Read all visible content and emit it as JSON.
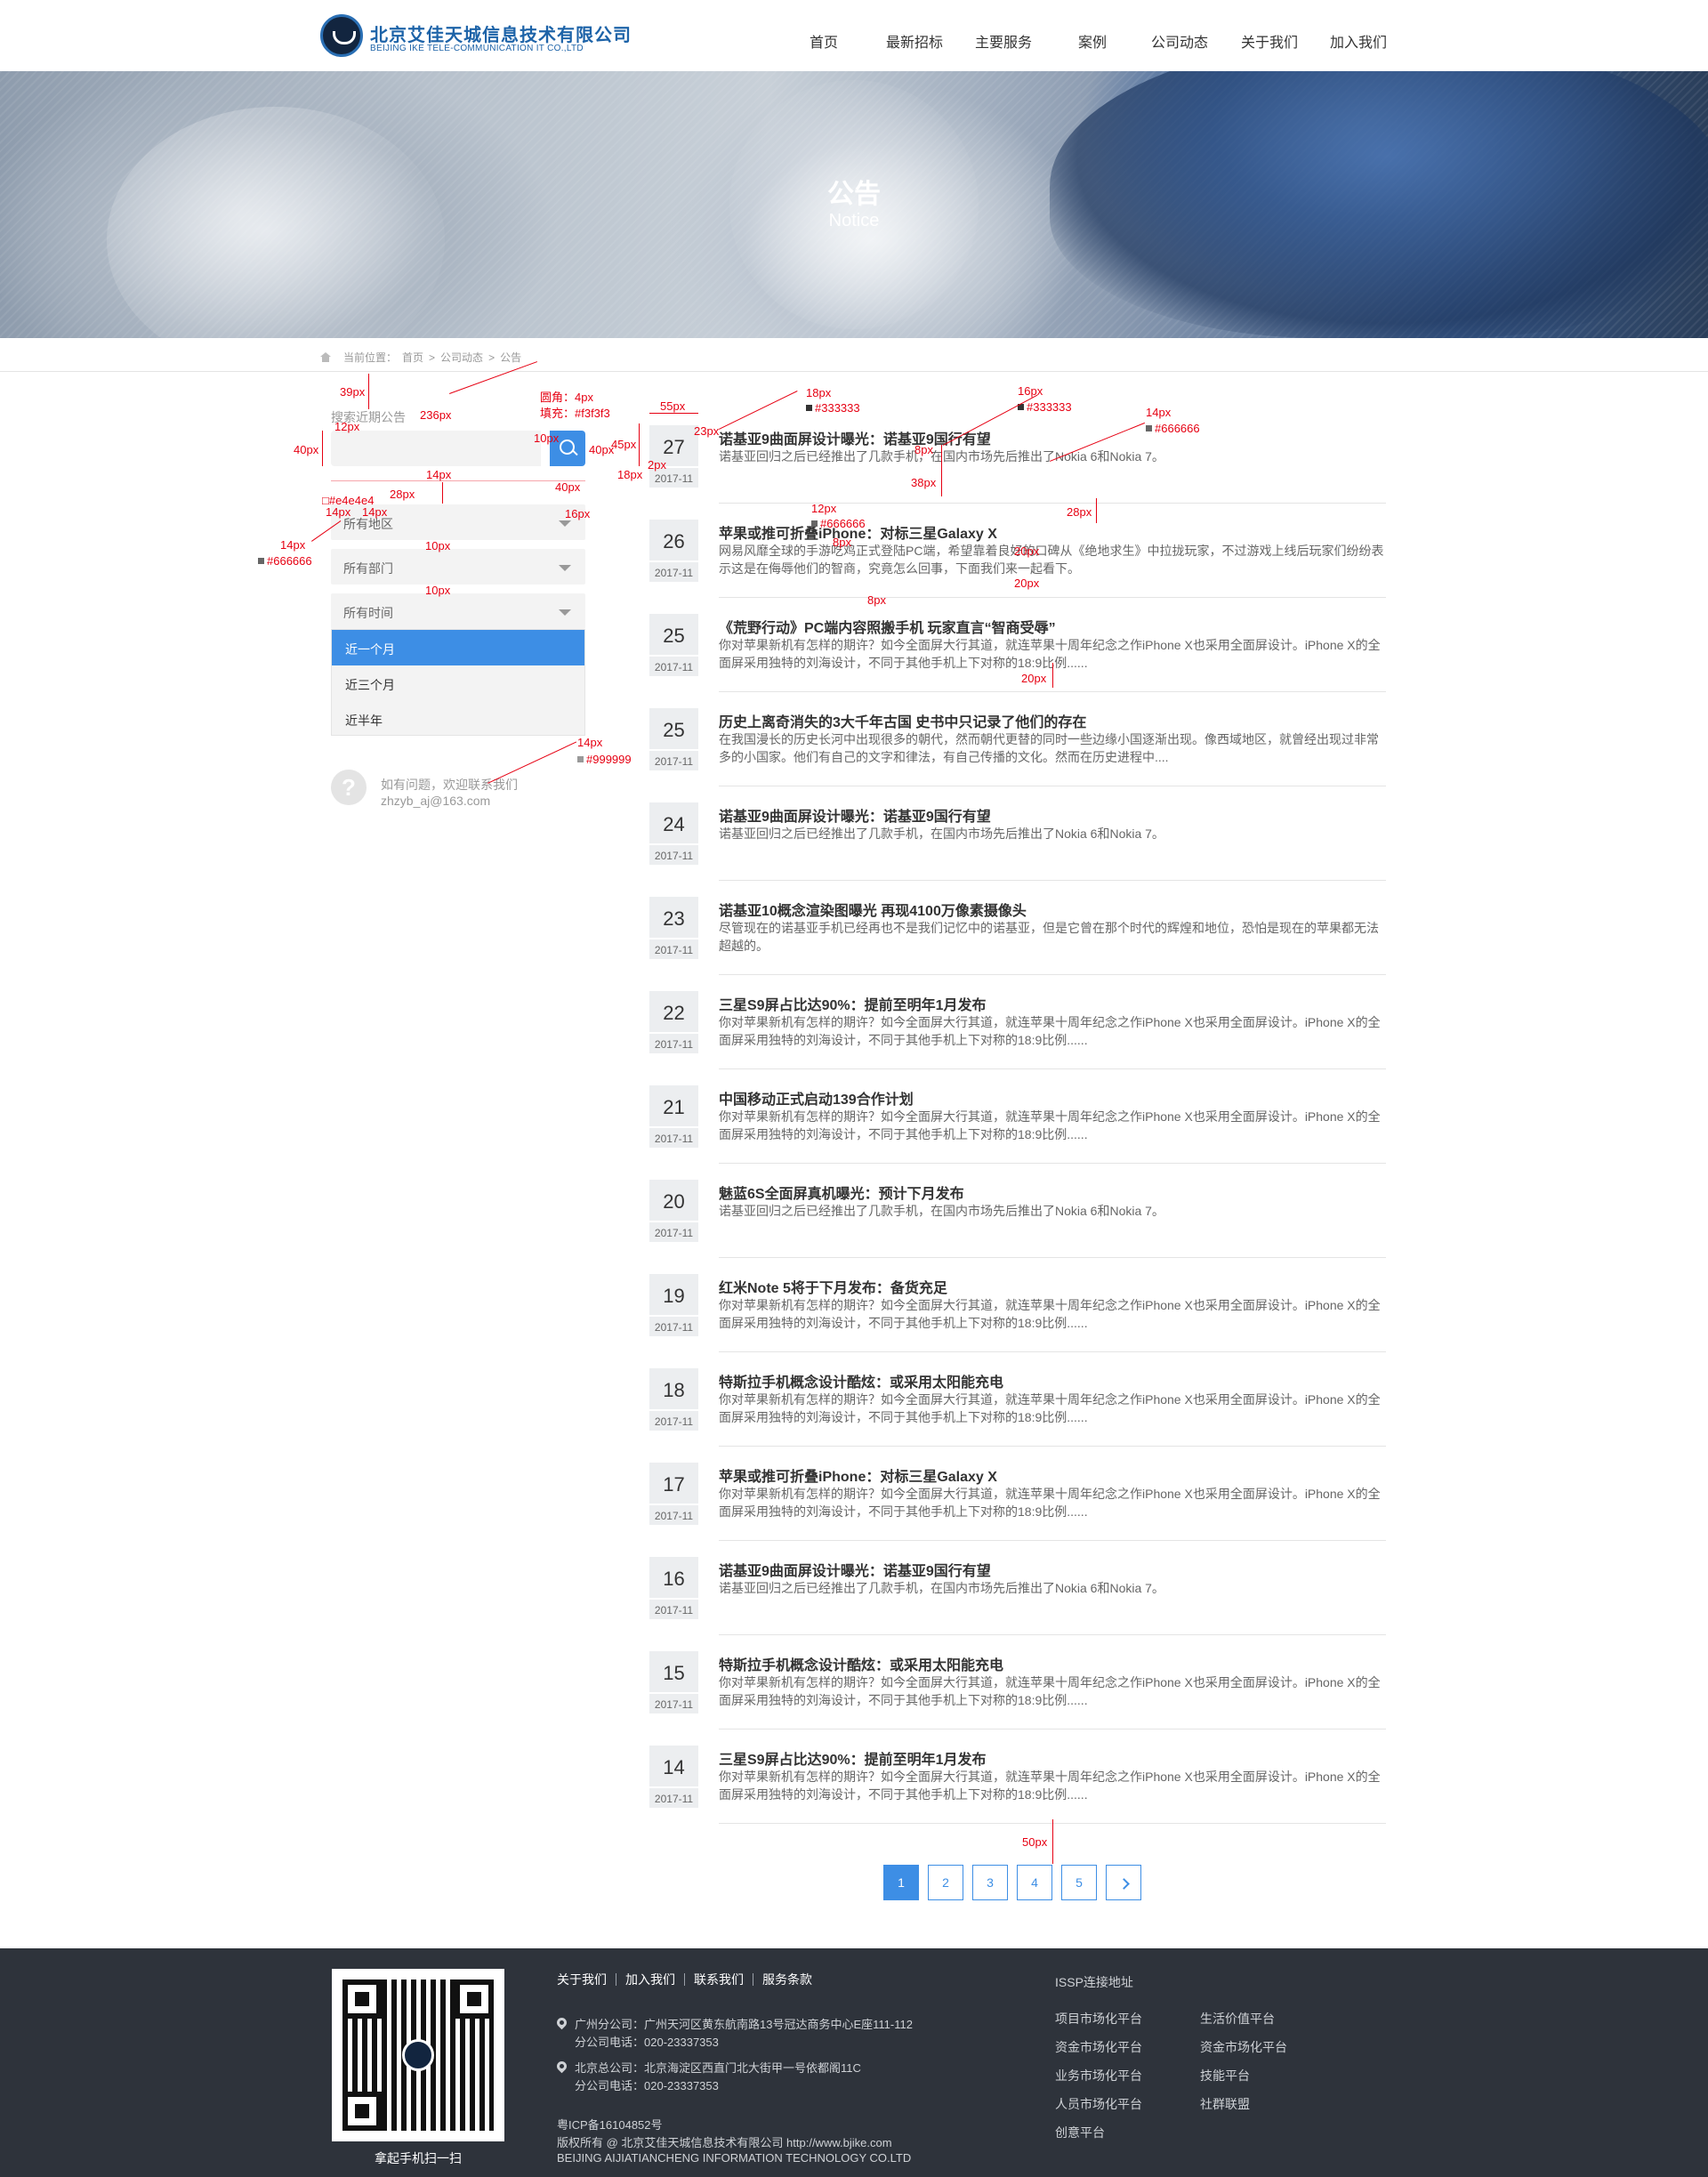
{
  "header": {
    "logo_cn": "北京艾佳天城信息技术有限公司",
    "logo_en": "BEIJING IKE TELE-COMMUNICATION IT CO.,LTD",
    "nav": [
      "首页",
      "最新招标",
      "主要服务",
      "案例",
      "公司动态",
      "关于我们",
      "加入我们"
    ]
  },
  "banner": {
    "title": "公告",
    "subtitle": "Notice"
  },
  "breadcrumb": {
    "prefix": "当前位置：",
    "items": [
      "首页",
      ">",
      "公司动态",
      ">",
      "公告"
    ]
  },
  "sidebar": {
    "search_label": "搜索近期公告",
    "search_placeholder": "",
    "selects": [
      "所有地区",
      "所有部门",
      "所有时间"
    ],
    "dropdown_options": [
      "近一个月",
      "近三个月",
      "近半年"
    ],
    "dropdown_active": "近一个月",
    "help_text": "如有问题，欢迎联系我们",
    "help_email": "zhzyb_aj@163.com",
    "help_icon": "question-icon"
  },
  "news": [
    {
      "day": "27",
      "ym": "2017-11",
      "title": "诺基亚9曲面屏设计曝光：诺基亚9国行有望",
      "desc": "诺基亚回归之后已经推出了几款手机，在国内市场先后推出了Nokia 6和Nokia 7。"
    },
    {
      "day": "26",
      "ym": "2017-11",
      "title": "苹果或推可折叠iPhone：对标三星Galaxy X",
      "desc": "网易风靡全球的手游吃鸡正式登陆PC端，希望靠着良好的口碑从《绝地求生》中拉拢玩家，不过游戏上线后玩家们纷纷表示这是在侮辱他们的智商，究竟怎么回事，下面我们来一起看下。"
    },
    {
      "day": "25",
      "ym": "2017-11",
      "title": "《荒野行动》PC端内容照搬手机 玩家直言“智商受辱”",
      "desc": "你对苹果新机有怎样的期许？如今全面屏大行其道，就连苹果十周年纪念之作iPhone X也采用全面屏设计。iPhone X的全面屏采用独特的刘海设计，不同于其他手机上下对称的18:9比例......"
    },
    {
      "day": "25",
      "ym": "2017-11",
      "title": "历史上离奇消失的3大千年古国 史书中只记录了他们的存在",
      "desc": "在我国漫长的历史长河中出现很多的朝代，然而朝代更替的同时一些边缘小国逐渐出现。像西域地区，就曾经出现过非常多的小国家。他们有自己的文字和律法，有自己传播的文化。然而在历史进程中...."
    },
    {
      "day": "24",
      "ym": "2017-11",
      "title": "诺基亚9曲面屏设计曝光：诺基亚9国行有望",
      "desc": "诺基亚回归之后已经推出了几款手机，在国内市场先后推出了Nokia 6和Nokia 7。"
    },
    {
      "day": "23",
      "ym": "2017-11",
      "title": "诺基亚10概念渲染图曝光 再现4100万像素摄像头",
      "desc": "尽管现在的诺基亚手机已经再也不是我们记忆中的诺基亚，但是它曾在那个时代的辉煌和地位，恐怕是现在的苹果都无法超越的。"
    },
    {
      "day": "22",
      "ym": "2017-11",
      "title": "三星S9屏占比达90%：提前至明年1月发布",
      "desc": "你对苹果新机有怎样的期许？如今全面屏大行其道，就连苹果十周年纪念之作iPhone X也采用全面屏设计。iPhone X的全面屏采用独特的刘海设计，不同于其他手机上下对称的18:9比例......"
    },
    {
      "day": "21",
      "ym": "2017-11",
      "title": "中国移动正式启动139合作计划",
      "desc": "你对苹果新机有怎样的期许？如今全面屏大行其道，就连苹果十周年纪念之作iPhone X也采用全面屏设计。iPhone X的全面屏采用独特的刘海设计，不同于其他手机上下对称的18:9比例......"
    },
    {
      "day": "20",
      "ym": "2017-11",
      "title": "魅蓝6S全面屏真机曝光：预计下月发布",
      "desc": "诺基亚回归之后已经推出了几款手机，在国内市场先后推出了Nokia 6和Nokia 7。"
    },
    {
      "day": "19",
      "ym": "2017-11",
      "title": "红米Note 5将于下月发布：备货充足",
      "desc": "你对苹果新机有怎样的期许？如今全面屏大行其道，就连苹果十周年纪念之作iPhone X也采用全面屏设计。iPhone X的全面屏采用独特的刘海设计，不同于其他手机上下对称的18:9比例......"
    },
    {
      "day": "18",
      "ym": "2017-11",
      "title": "特斯拉手机概念设计酷炫：或采用太阳能充电",
      "desc": "你对苹果新机有怎样的期许？如今全面屏大行其道，就连苹果十周年纪念之作iPhone X也采用全面屏设计。iPhone X的全面屏采用独特的刘海设计，不同于其他手机上下对称的18:9比例......"
    },
    {
      "day": "17",
      "ym": "2017-11",
      "title": "苹果或推可折叠iPhone：对标三星Galaxy X",
      "desc": "你对苹果新机有怎样的期许？如今全面屏大行其道，就连苹果十周年纪念之作iPhone X也采用全面屏设计。iPhone X的全面屏采用独特的刘海设计，不同于其他手机上下对称的18:9比例......"
    },
    {
      "day": "16",
      "ym": "2017-11",
      "title": "诺基亚9曲面屏设计曝光：诺基亚9国行有望",
      "desc": "诺基亚回归之后已经推出了几款手机，在国内市场先后推出了Nokia 6和Nokia 7。"
    },
    {
      "day": "15",
      "ym": "2017-11",
      "title": "特斯拉手机概念设计酷炫：或采用太阳能充电",
      "desc": "你对苹果新机有怎样的期许？如今全面屏大行其道，就连苹果十周年纪念之作iPhone X也采用全面屏设计。iPhone X的全面屏采用独特的刘海设计，不同于其他手机上下对称的18:9比例......"
    },
    {
      "day": "14",
      "ym": "2017-11",
      "title": "三星S9屏占比达90%：提前至明年1月发布",
      "desc": "你对苹果新机有怎样的期许？如今全面屏大行其道，就连苹果十周年纪念之作iPhone X也采用全面屏设计。iPhone X的全面屏采用独特的刘海设计，不同于其他手机上下对称的18:9比例......"
    }
  ],
  "pagination": {
    "pages": [
      "1",
      "2",
      "3",
      "4",
      "5"
    ],
    "active": "1",
    "next_icon": "chevron-right-icon"
  },
  "annotations": {
    "sidebar": [
      "39px",
      "12px",
      "236px",
      "圆角：4px",
      "填充：#f3f3f3",
      "10px",
      "40px",
      "40px",
      "45px",
      "18px",
      "14px",
      "28px",
      "□#e4e4e4",
      "14px",
      "14px",
      "40px",
      "16px",
      "14px",
      "■#666666",
      "10px",
      "10px",
      "14px",
      "■#999999"
    ],
    "list": [
      "55px",
      "18px",
      "■#333333",
      "16px",
      "■#333333",
      "14px",
      "■#666666",
      "23px",
      "8px",
      "2px",
      "38px",
      "12px",
      "■#666666",
      "28px",
      "8px",
      "8px",
      "20px",
      "20px",
      "20px",
      "50px"
    ],
    "colors": {
      "red": "#e60012"
    }
  },
  "footer": {
    "links": [
      "关于我们",
      "加入我们",
      "联系我们",
      "服务条款"
    ],
    "addresses": [
      {
        "title": "广州分公司：广州天河区黄东航南路13号冠达商务中心E座111-112",
        "phone": "分公司电话：020-23337353"
      },
      {
        "title": "北京总公司：北京海淀区西直门北大街甲一号依都阁11C",
        "phone": "分公司电话：020-23337353"
      }
    ],
    "icp": "粤ICP备16104852号",
    "copyright": "版权所有 @ 北京艾佳天城信息技术有限公司 http://www.bjike.com",
    "company_en": "BEIJING AIJIATIANCHENG INFORMATION TECHNOLOGY CO.LTD",
    "qr_caption": "拿起手机扫一扫",
    "issp_title": "ISSP连接地址",
    "issp_left": [
      "项目市场化平台",
      "资金市场化平台",
      "业务市场化平台",
      "人员市场化平台",
      "创意平台"
    ],
    "issp_right": [
      "生活价值平台",
      "资金市场化平台",
      "技能平台",
      "社群联盟"
    ]
  },
  "colors": {
    "accent": "#3d8ee5",
    "footer_bg": "#2e333b",
    "input_bg": "#f3f3f3",
    "border": "#e4e4e4"
  }
}
